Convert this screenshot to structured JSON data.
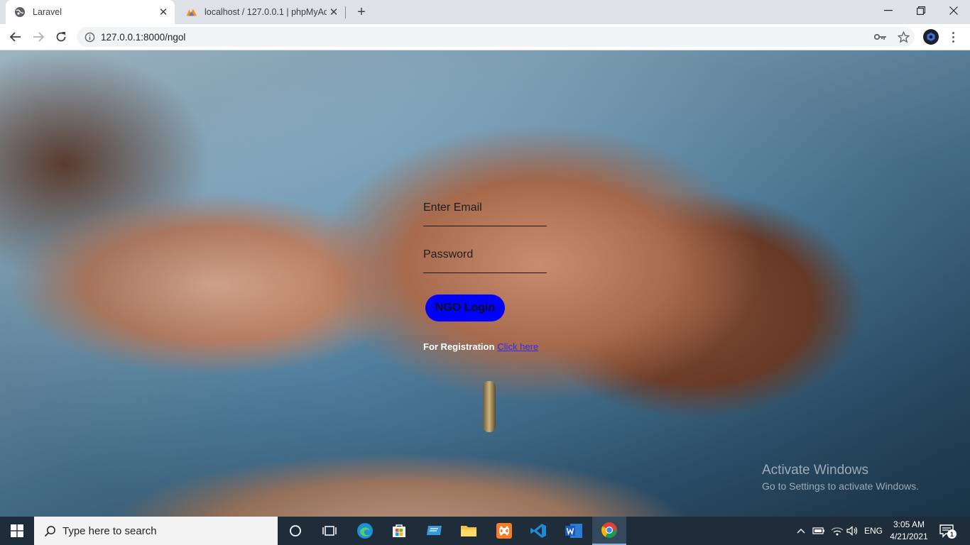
{
  "browser": {
    "tabs": [
      {
        "title": "Laravel",
        "active": true
      },
      {
        "title": "localhost / 127.0.0.1 | phpMyAdm",
        "active": false
      }
    ],
    "url": "127.0.0.1:8000/ngol"
  },
  "login": {
    "email_placeholder": "Enter Email",
    "password_placeholder": "Password",
    "submit_label": "NGO Login",
    "register_text": "For Registration",
    "register_link": "Click here"
  },
  "watermark": {
    "title": "Activate Windows",
    "subtitle": "Go to Settings to activate Windows."
  },
  "taskbar": {
    "search_placeholder": "Type here to search",
    "language": "ENG",
    "time": "3:05 AM",
    "date": "4/21/2021",
    "notification_count": "1"
  },
  "colors": {
    "login_button": "#0000ff",
    "taskbar": "#1f2d3a",
    "tab_strip": "#dee1e6"
  }
}
